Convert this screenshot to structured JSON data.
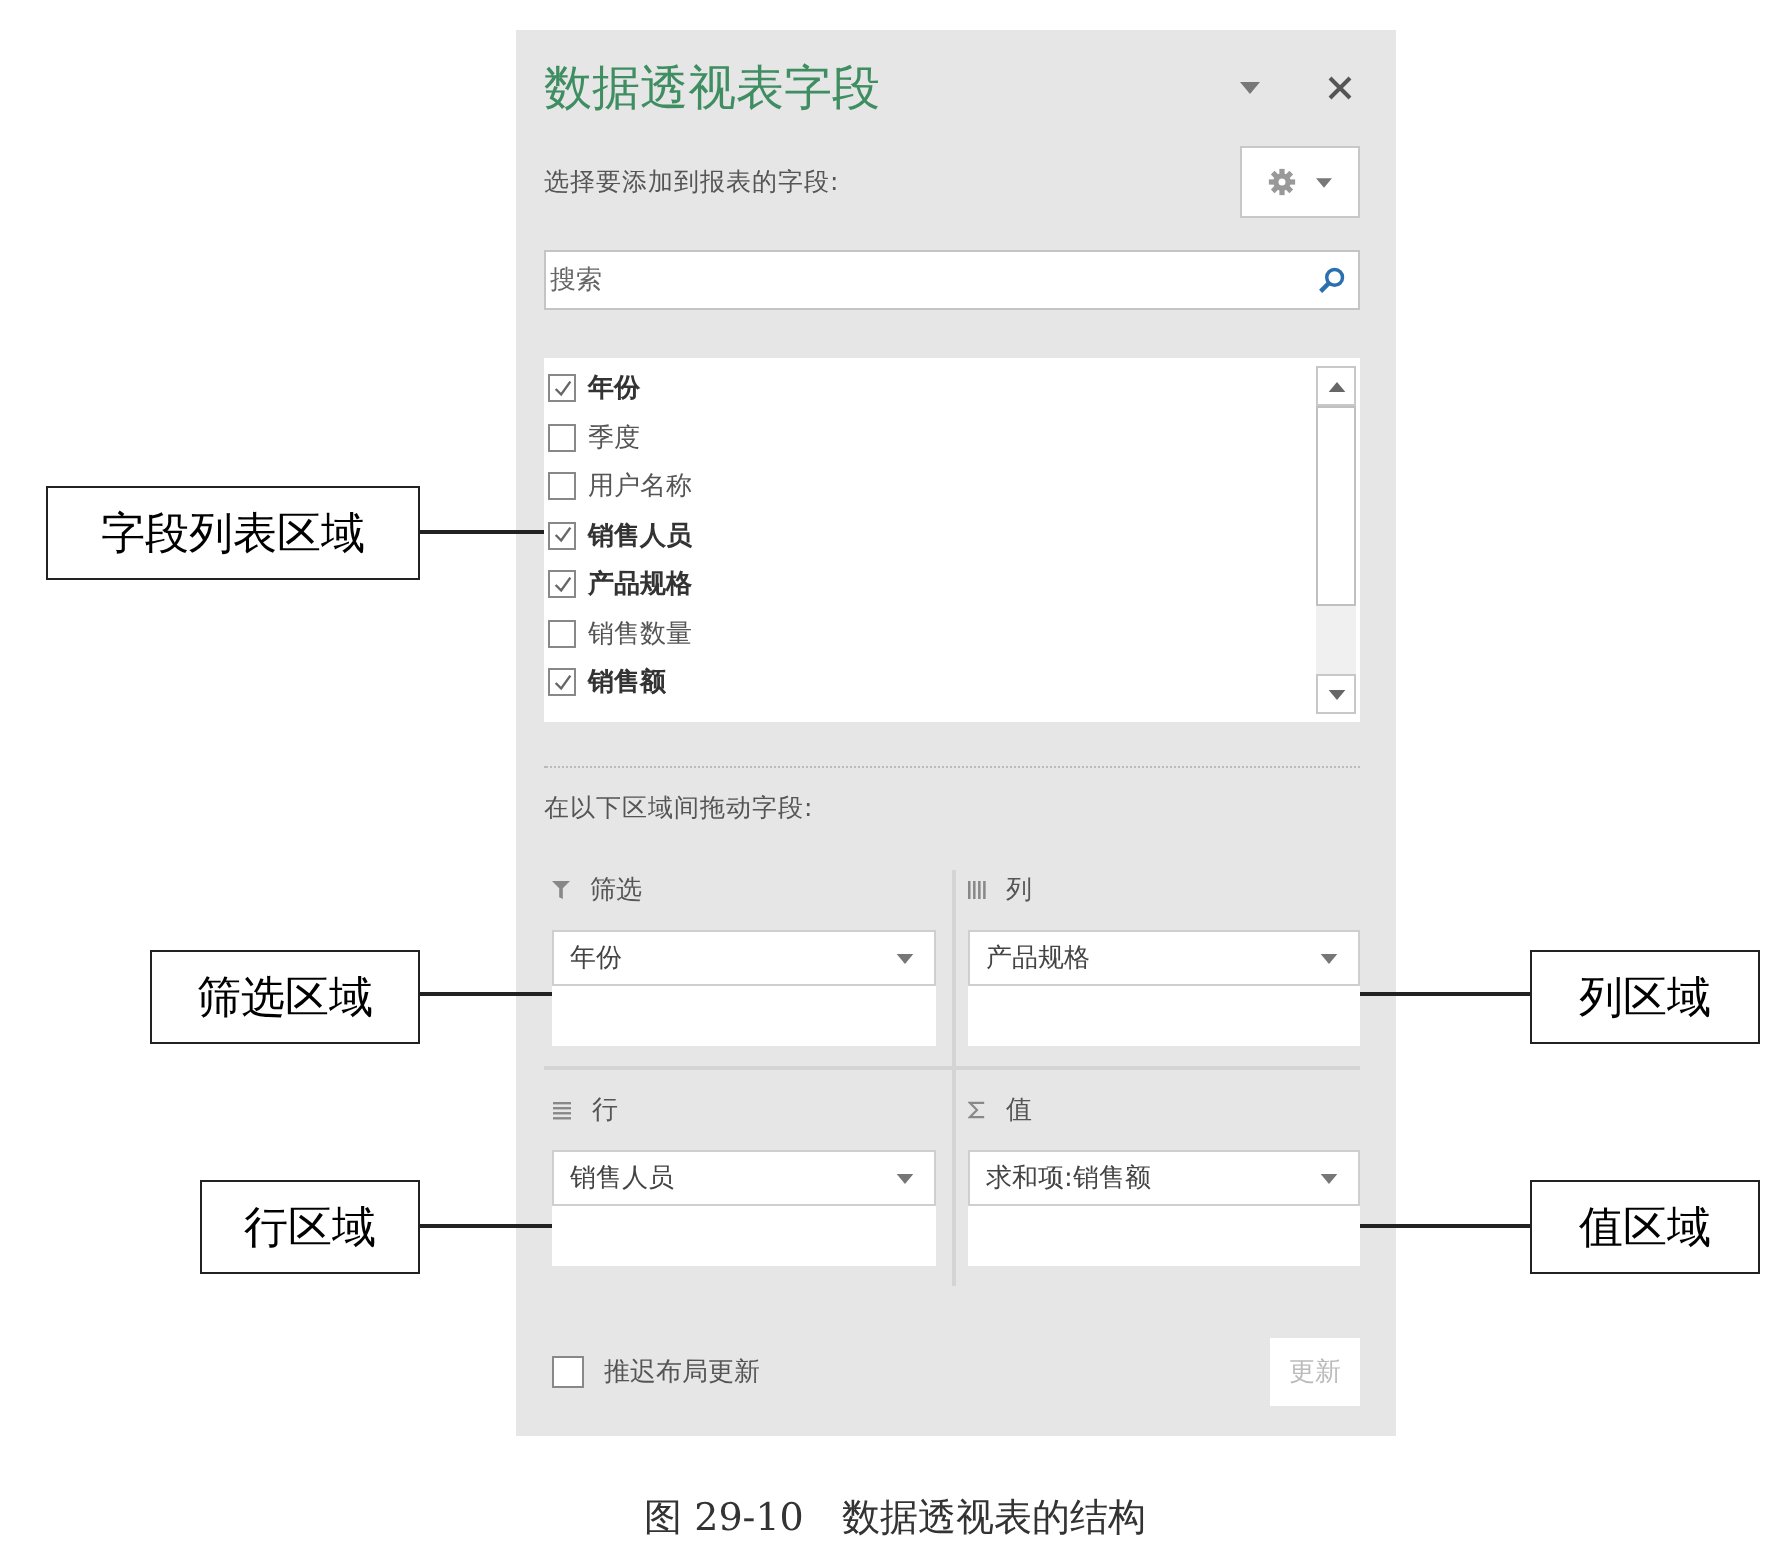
{
  "panel": {
    "title": "数据透视表字段",
    "subtitle": "选择要添加到报表的字段:",
    "search": {
      "placeholder": "搜索"
    },
    "fields": [
      {
        "label": "年份",
        "checked": true
      },
      {
        "label": "季度",
        "checked": false
      },
      {
        "label": "用户名称",
        "checked": false
      },
      {
        "label": "销售人员",
        "checked": true
      },
      {
        "label": "产品规格",
        "checked": true
      },
      {
        "label": "销售数量",
        "checked": false
      },
      {
        "label": "销售额",
        "checked": true
      }
    ],
    "drag_hint": "在以下区域间拖动字段:",
    "areas": [
      {
        "kind": "filter",
        "label": "筛选",
        "items": [
          "年份"
        ]
      },
      {
        "kind": "columns",
        "label": "列",
        "items": [
          "产品规格"
        ]
      },
      {
        "kind": "rows",
        "label": "行",
        "items": [
          "销售人员"
        ]
      },
      {
        "kind": "values",
        "label": "值",
        "items": [
          "求和项:销售额"
        ]
      }
    ],
    "defer_update": {
      "label": "推迟布局更新",
      "checked": false
    },
    "update_button": {
      "label": "更新",
      "disabled": true
    }
  },
  "callouts": [
    {
      "label": "字段列表区域"
    },
    {
      "label": "筛选区域"
    },
    {
      "label": "列区域"
    },
    {
      "label": "行区域"
    },
    {
      "label": "值区域"
    }
  ],
  "caption": "图 29-10　数据透视表的结构"
}
